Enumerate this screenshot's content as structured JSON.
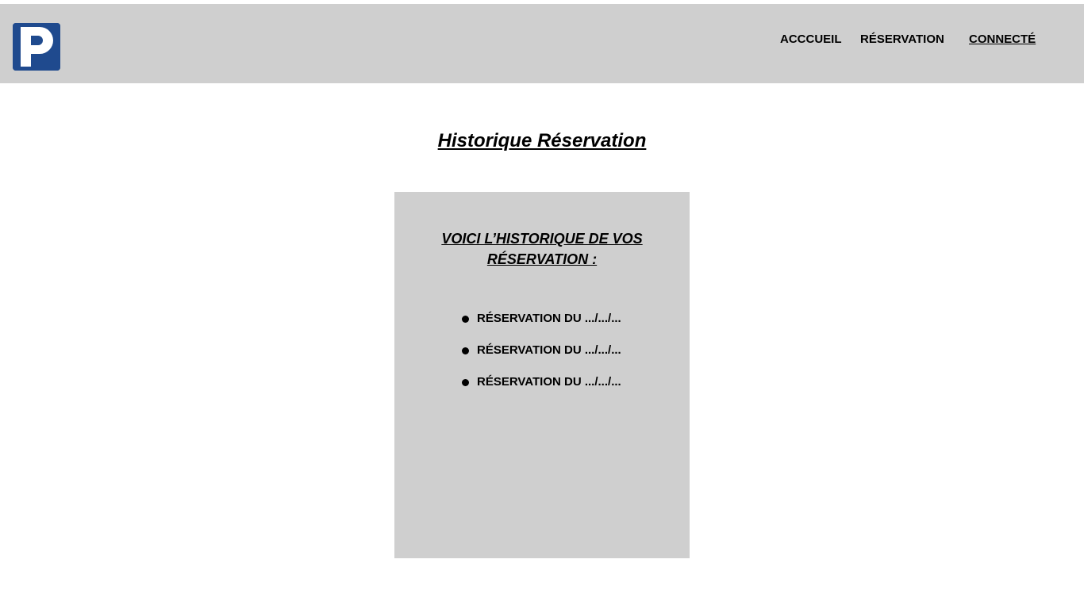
{
  "header": {
    "logo_letter": "P",
    "logo_color": "#1f4a8e",
    "background_color": "#cfcfcf",
    "nav": [
      {
        "label": "ACCCUEIL"
      },
      {
        "label": "RÉSERVATION"
      },
      {
        "label": "CONNECTÉ",
        "active": true
      }
    ]
  },
  "main": {
    "title": "Historique Réservation",
    "card": {
      "title": "VOICI L’HISTORIQUE DE VOS \nRÉSERVATION :",
      "items": [
        {
          "label": "RÉSERVATION DU .../.../..."
        },
        {
          "label": "RÉSERVATION DU .../.../..."
        },
        {
          "label": "RÉSERVATION DU .../.../..."
        }
      ]
    }
  }
}
